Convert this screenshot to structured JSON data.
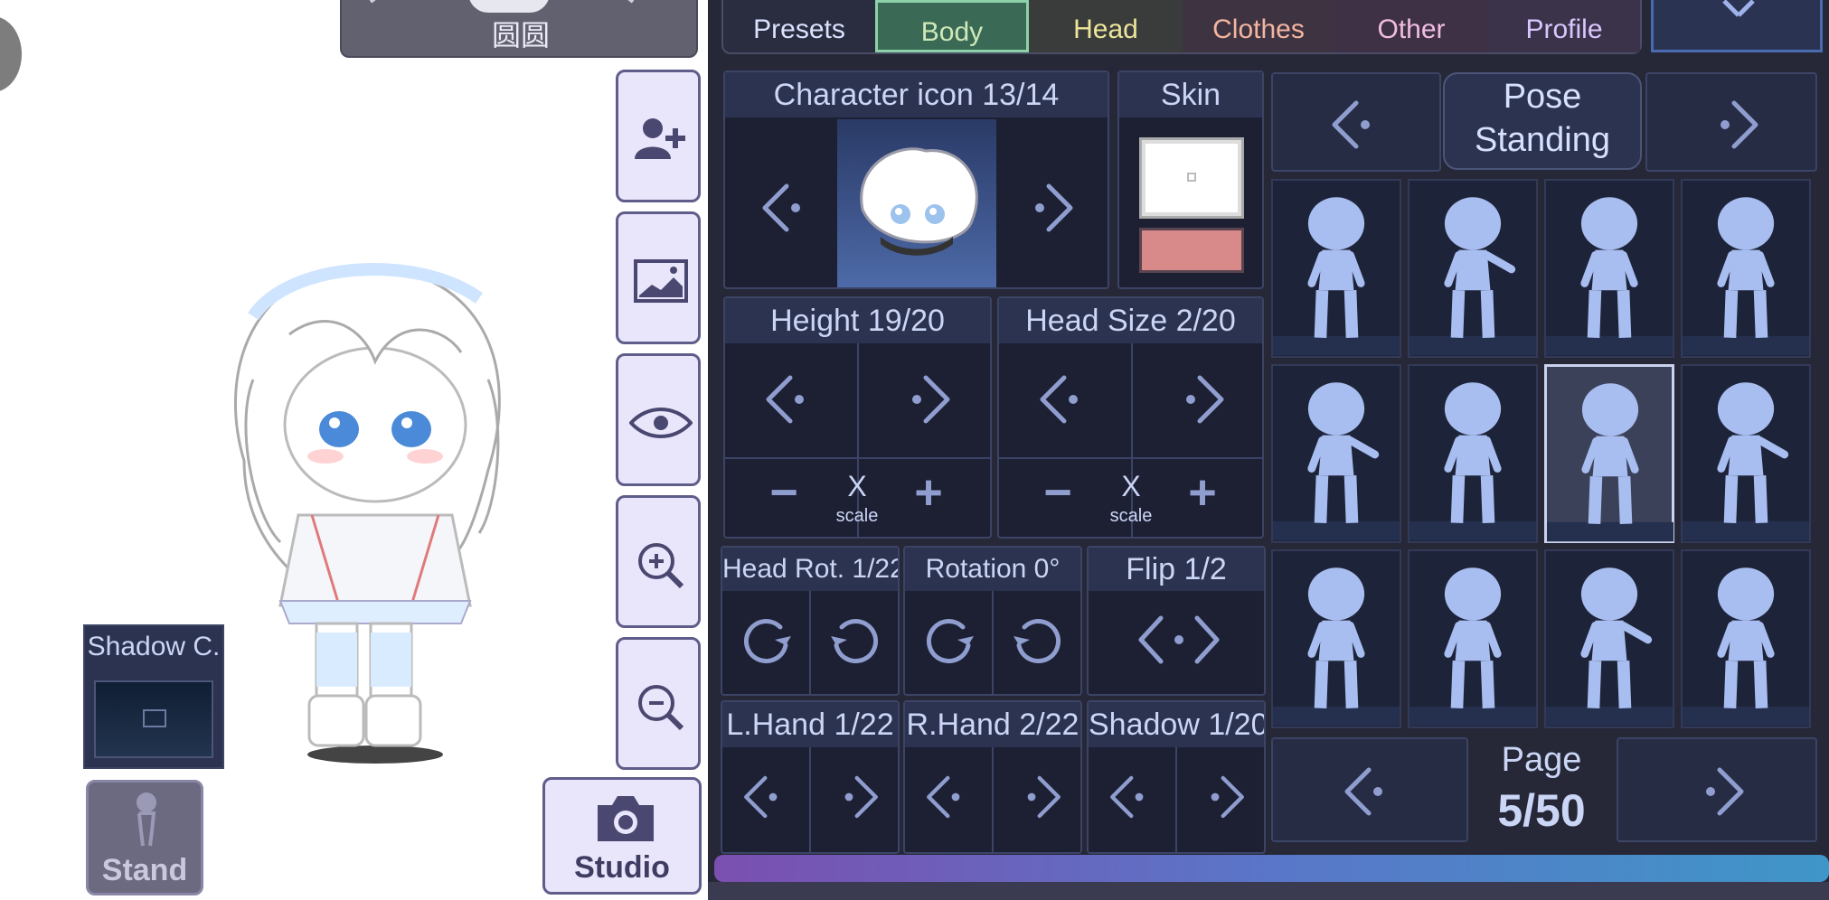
{
  "header": {
    "character_name": "圆圆"
  },
  "tabs": [
    {
      "label": "Presets",
      "color": "#dbe2ff"
    },
    {
      "label": "Body",
      "color": "#cfe8b8"
    },
    {
      "label": "Head",
      "color": "#ece59a"
    },
    {
      "label": "Clothes",
      "color": "#f4b5a0"
    },
    {
      "label": "Other",
      "color": "#f0bde0"
    },
    {
      "label": "Profile",
      "color": "#d9c6ff"
    }
  ],
  "sidebar": {
    "add_character_icon": "add-user-icon",
    "background_icon": "image-icon",
    "visibility_icon": "eye-icon",
    "zoom_in_icon": "zoom-in-icon",
    "zoom_out_icon": "zoom-out-icon",
    "studio_label": "Studio",
    "stand_label": "Stand"
  },
  "shadow_color": {
    "label": "Shadow C."
  },
  "character_icon": {
    "label": "Character icon 13/14"
  },
  "skin": {
    "label": "Skin",
    "swatch_top": "#ffffff",
    "swatch_bottom": "#d88a8a"
  },
  "height": {
    "label": "Height 19/20",
    "scale_label": "X",
    "scale_sub": "scale",
    "minus": "−",
    "plus": "+"
  },
  "head_size": {
    "label": "Head Size 2/20",
    "scale_label": "X",
    "scale_sub": "scale",
    "minus": "−",
    "plus": "+"
  },
  "head_rotation": {
    "label": "Head Rot. 1/22"
  },
  "rotation": {
    "label": "Rotation 0°"
  },
  "flip": {
    "label": "Flip 1/2"
  },
  "left_hand": {
    "label": "L.Hand 1/22"
  },
  "right_hand": {
    "label": "R.Hand 2/22"
  },
  "shadow": {
    "label": "Shadow 1/20"
  },
  "pose": {
    "title": "Pose",
    "value": "Standing",
    "selected_index": 6,
    "count": 12
  },
  "page": {
    "label": "Page",
    "value": "5/50"
  },
  "colors": {
    "panel": "#262838",
    "accent": "#8f9ecf",
    "pose_figure": "#a8bdf0"
  }
}
